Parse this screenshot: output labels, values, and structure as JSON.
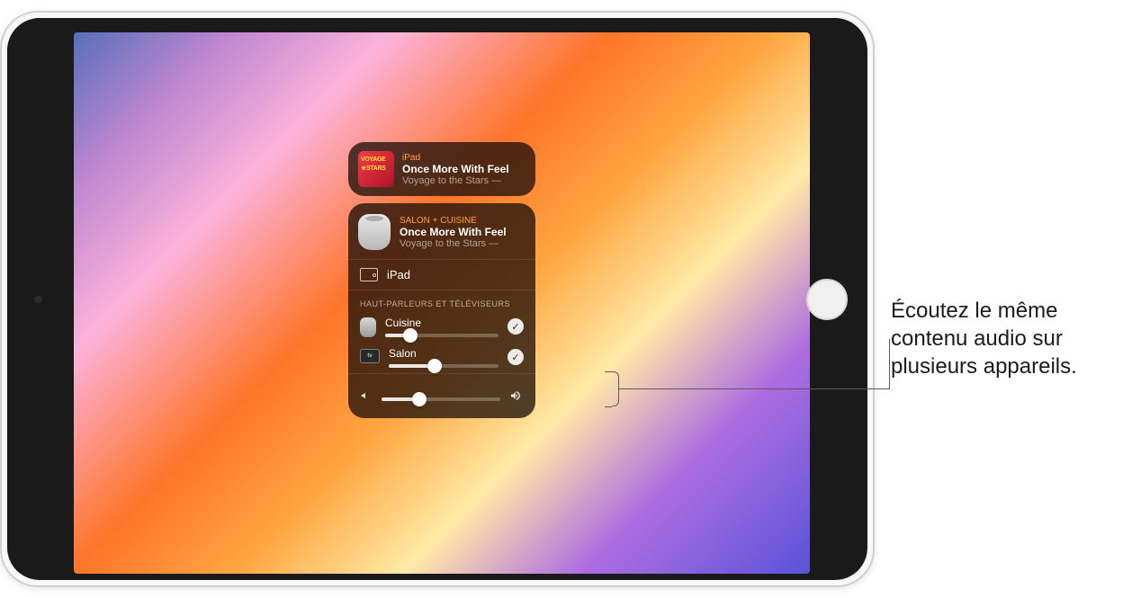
{
  "now_playing_small": {
    "device": "iPad",
    "title": "Once More With Feel",
    "subtitle": "Voyage to the Stars —"
  },
  "now_playing_large": {
    "device": "SALON + CUISINE",
    "title": "Once More With Feel",
    "subtitle": "Voyage to the Stars —"
  },
  "device_row_label": "iPad",
  "section_header": "HAUT-PARLEURS ET TÉLÉVISEURS",
  "outputs": [
    {
      "label": "Cuisine",
      "volume_pct": 22
    },
    {
      "label": "Salon",
      "volume_pct": 42
    }
  ],
  "master_volume_pct": 32,
  "callout_text": "Écoutez le même contenu audio sur plusieurs appareils."
}
